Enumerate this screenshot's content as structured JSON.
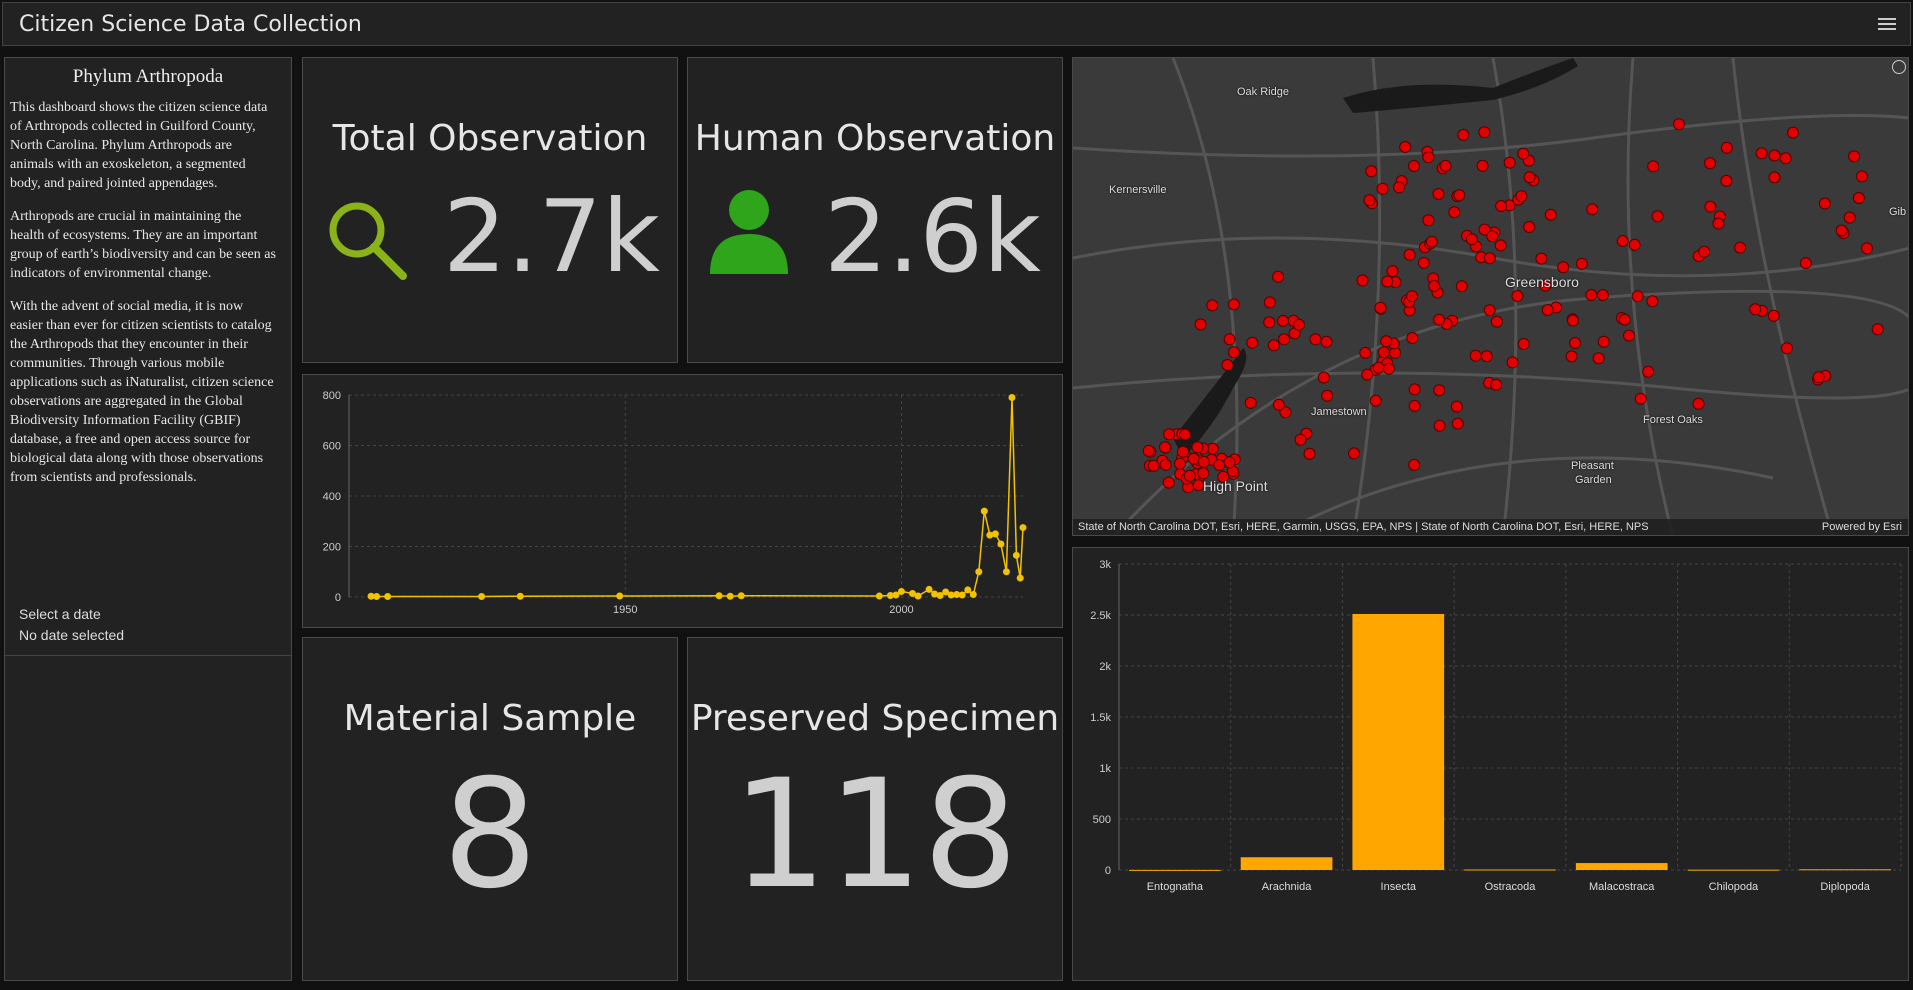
{
  "header": {
    "title": "Citizen Science Data Collection"
  },
  "sidebar": {
    "heading": "Phylum Arthropoda",
    "paragraphs": [
      "This dashboard shows the citizen science data of Arthropods collected in Guilford County, North Carolina. Phylum Arthropods are animals with an exoskeleton, a segmented body, and paired jointed appendages.",
      "Arthropods are crucial in maintaining the health of ecosystems. They are an important group of earth’s biodiversity and can be seen as indicators of environmental change.",
      "With the advent of social media, it is now easier than ever for citizen scientists to catalog the Arthropods that they encounter in their communities. Through various mobile applications such as iNaturalist, citizen science observations are aggregated in the Global Biodiversity Information Facility (GBIF) database, a free and open access source for biological data along with those observations from scientists and professionals."
    ],
    "date_label": "Select a date",
    "date_value": "No date selected"
  },
  "kpis": {
    "total": {
      "title": "Total Observation",
      "value": "2.7k",
      "icon": "search-icon",
      "icon_color": "#8ab31a"
    },
    "human": {
      "title": "Human Observation",
      "value": "2.6k",
      "icon": "person-icon",
      "icon_color": "#2ea51a"
    },
    "material": {
      "title": "Material Sample",
      "value": "8"
    },
    "preserved": {
      "title": "Preserved Specimen",
      "value": "118"
    }
  },
  "map": {
    "labels": [
      "Oak Ridge",
      "Kernersville",
      "Greensboro",
      "Jamestown",
      "Forest Oaks",
      "Pleasant",
      "Garden",
      "High Point",
      "Gib"
    ],
    "attribution": "State of North Carolina DOT, Esri, HERE, Garmin, USGS, EPA, NPS | State of North Carolina DOT, Esri, HERE, NPS",
    "powered": "Powered by Esri",
    "point_color": "#e00000"
  },
  "chart_data": [
    {
      "type": "line",
      "title": "",
      "x": [
        1904,
        1905,
        1907,
        1924,
        1931,
        1949,
        1967,
        1969,
        1971,
        1996,
        1998,
        1999,
        2000,
        2002,
        2003,
        2005,
        2006,
        2007,
        2008,
        2009,
        2010,
        2011,
        2012,
        2013,
        2014,
        2015,
        2016,
        2017,
        2018,
        2019,
        2020
      ],
      "y": [
        3,
        2,
        2,
        2,
        3,
        4,
        5,
        3,
        5,
        4,
        6,
        8,
        22,
        14,
        4,
        30,
        12,
        6,
        20,
        8,
        10,
        8,
        28,
        10,
        100,
        340,
        245,
        250,
        210,
        100,
        790
      ],
      "y_tail": [
        165,
        75,
        275
      ],
      "ylim": [
        0,
        800
      ],
      "yticks": [
        0,
        200,
        400,
        600,
        800
      ],
      "xticks": [
        1950,
        2000
      ],
      "color": "#f2c200",
      "grid": true
    },
    {
      "type": "bar",
      "title": "",
      "categories": [
        "Entognatha",
        "Arachnida",
        "Insecta",
        "Ostracoda",
        "Malacostraca",
        "Chilopoda",
        "Diplopoda"
      ],
      "values": [
        1,
        125,
        2510,
        5,
        68,
        3,
        7
      ],
      "ylim": [
        0,
        3000
      ],
      "yticks": [
        0,
        500,
        1000,
        1500,
        2000,
        2500,
        3000
      ],
      "ytick_labels": [
        "0",
        "500",
        "1k",
        "1.5k",
        "2k",
        "2.5k",
        "3k"
      ],
      "color": "#ffa600",
      "grid": true
    }
  ]
}
